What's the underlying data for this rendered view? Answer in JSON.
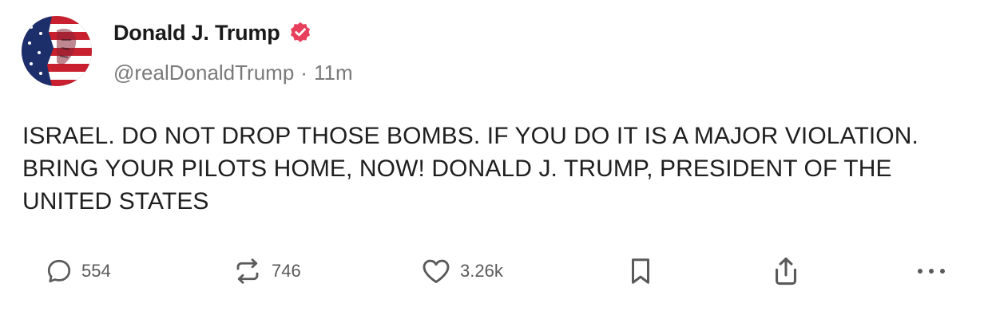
{
  "author": {
    "display_name": "Donald J. Trump",
    "handle": "@realDonaldTrump",
    "separator": "·",
    "timestamp": "11m",
    "verified": true,
    "verified_color": "#e7405c"
  },
  "post": {
    "text": "ISRAEL. DO NOT DROP THOSE BOMBS. IF YOU DO IT IS A MAJOR VIOLATION. BRING YOUR PILOTS HOME, NOW! DONALD J. TRUMP, PRESIDENT OF THE UNITED STATES"
  },
  "actions": {
    "reply": {
      "icon": "comment-icon",
      "count": "554"
    },
    "repost": {
      "icon": "repost-icon",
      "count": "746"
    },
    "like": {
      "icon": "heart-icon",
      "count": "3.26k"
    },
    "bookmark": {
      "icon": "bookmark-icon"
    },
    "share": {
      "icon": "share-icon"
    },
    "more": {
      "icon": "more-icon"
    }
  },
  "colors": {
    "text": "#1f1f1f",
    "muted": "#7a7a7a",
    "icon": "#5a5a5a"
  }
}
